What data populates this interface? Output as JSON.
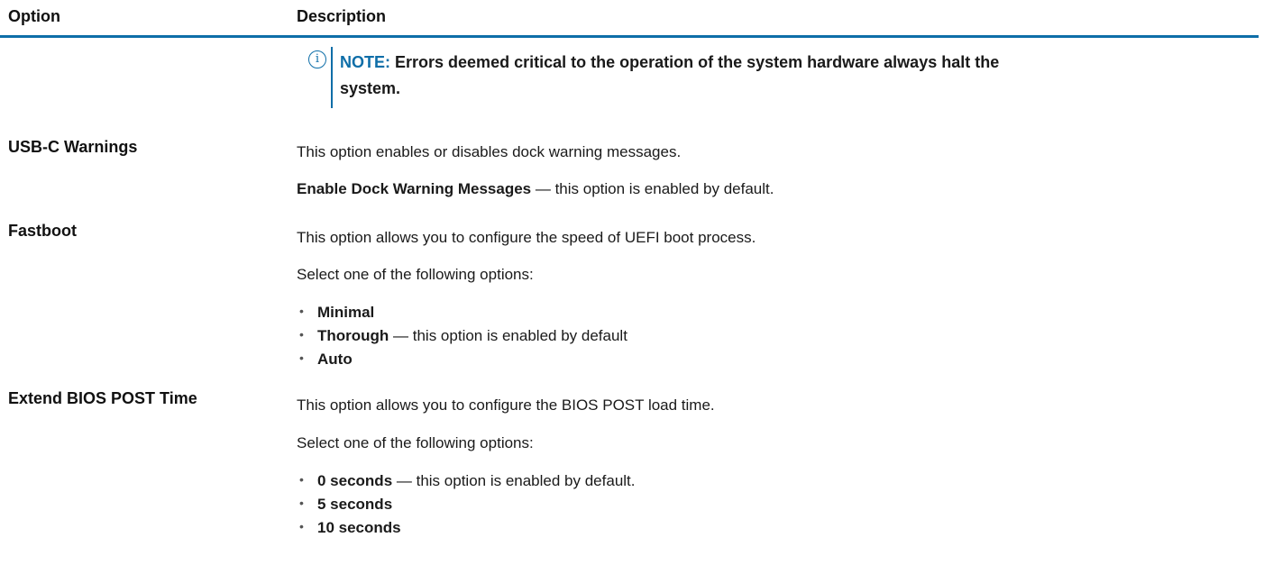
{
  "table": {
    "headers": {
      "option": "Option",
      "description": "Description"
    },
    "note": {
      "icon": "info-icon",
      "icon_glyph": "i",
      "label": "NOTE:",
      "text": "Errors deemed critical to the operation of the system hardware always halt the system.",
      "line1": "Errors deemed critical to the operation of the system hardware always halt the",
      "line2": "system."
    },
    "rows": [
      {
        "option": "USB-C Warnings",
        "description": "This option enables or disables dock warning messages.",
        "setting_name": "Enable Dock Warning Messages",
        "setting_suffix": " — this option is enabled by default."
      },
      {
        "option": "Fastboot",
        "description": "This option allows you to configure the speed of UEFI boot process.",
        "prompt": "Select one of the following options:",
        "choices": [
          {
            "name": "Minimal",
            "suffix": ""
          },
          {
            "name": "Thorough",
            "suffix": " — this option is enabled by default"
          },
          {
            "name": "Auto",
            "suffix": ""
          }
        ]
      },
      {
        "option": "Extend BIOS POST Time",
        "description": "This option allows you to configure the BIOS POST load time.",
        "prompt": "Select one of the following options:",
        "choices": [
          {
            "name": "0 seconds",
            "suffix": " — this option is enabled by default."
          },
          {
            "name": "5 seconds",
            "suffix": ""
          },
          {
            "name": "10 seconds",
            "suffix": ""
          }
        ]
      }
    ],
    "bullet_glyph": "•"
  },
  "colors": {
    "accent": "#0e6ea8",
    "text": "#1a1a1a"
  }
}
